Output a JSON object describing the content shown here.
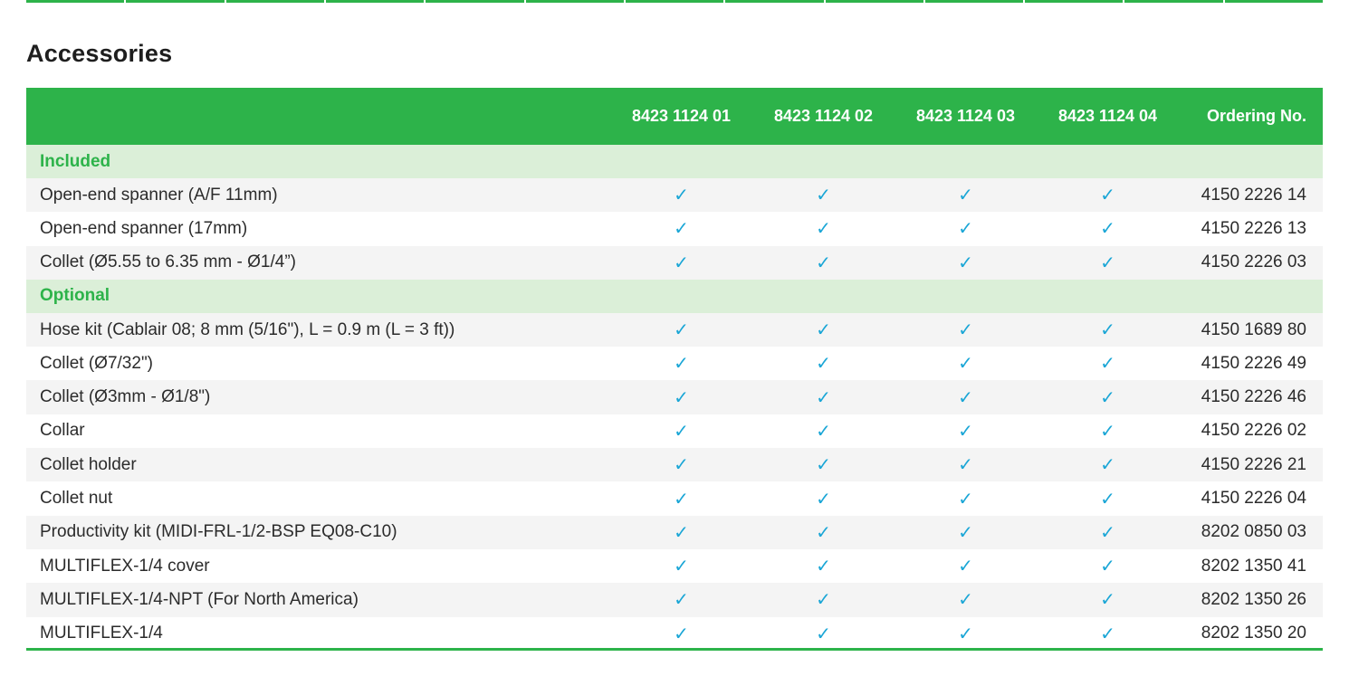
{
  "section_title": "Accessories",
  "table": {
    "header": {
      "description": "",
      "models": [
        "8423 1124 01",
        "8423 1124 02",
        "8423 1124 03",
        "8423 1124 04"
      ],
      "ordering": "Ordering No."
    },
    "check_glyph": "✓",
    "groups": [
      {
        "name": "Included",
        "items": [
          {
            "description": "Open-end spanner (A/F 11mm)",
            "ordering_no": "4150 2226 14",
            "availability": [
              true,
              true,
              true,
              true
            ]
          },
          {
            "description": "Open-end spanner (17mm)",
            "ordering_no": "4150 2226 13",
            "availability": [
              true,
              true,
              true,
              true
            ]
          },
          {
            "description": "Collet (Ø5.55 to 6.35 mm - Ø1/4”)",
            "ordering_no": "4150 2226 03",
            "availability": [
              true,
              true,
              true,
              true
            ]
          }
        ]
      },
      {
        "name": "Optional",
        "items": [
          {
            "description": "Hose kit (Cablair 08; 8 mm (5/16\"), L = 0.9 m (L = 3 ft))",
            "ordering_no": "4150 1689 80",
            "availability": [
              true,
              true,
              true,
              true
            ]
          },
          {
            "description": "Collet (Ø7/32\")",
            "ordering_no": "4150 2226 49",
            "availability": [
              true,
              true,
              true,
              true
            ]
          },
          {
            "description": "Collet (Ø3mm - Ø1/8\")",
            "ordering_no": "4150 2226 46",
            "availability": [
              true,
              true,
              true,
              true
            ]
          },
          {
            "description": "Collar",
            "ordering_no": "4150 2226 02",
            "availability": [
              true,
              true,
              true,
              true
            ]
          },
          {
            "description": "Collet holder",
            "ordering_no": "4150 2226 21",
            "availability": [
              true,
              true,
              true,
              true
            ]
          },
          {
            "description": "Collet nut",
            "ordering_no": "4150 2226 04",
            "availability": [
              true,
              true,
              true,
              true
            ]
          },
          {
            "description": "Productivity kit (MIDI-FRL-1/2-BSP EQ08-C10)",
            "ordering_no": "8202 0850 03",
            "availability": [
              true,
              true,
              true,
              true
            ]
          },
          {
            "description": "MULTIFLEX-1/4 cover",
            "ordering_no": "8202 1350 41",
            "availability": [
              true,
              true,
              true,
              true
            ]
          },
          {
            "description": "MULTIFLEX-1/4-NPT (For North America)",
            "ordering_no": "8202 1350 26",
            "availability": [
              true,
              true,
              true,
              true
            ]
          },
          {
            "description": "MULTIFLEX-1/4",
            "ordering_no": "8202 1350 20",
            "availability": [
              true,
              true,
              true,
              true
            ]
          }
        ]
      }
    ]
  },
  "colors": {
    "brand_green": "#2db34a",
    "group_band": "#dbefd8",
    "check_blue": "#1aa6d6",
    "stripe": "#f4f4f4"
  },
  "icons": {
    "check": "check-icon"
  }
}
